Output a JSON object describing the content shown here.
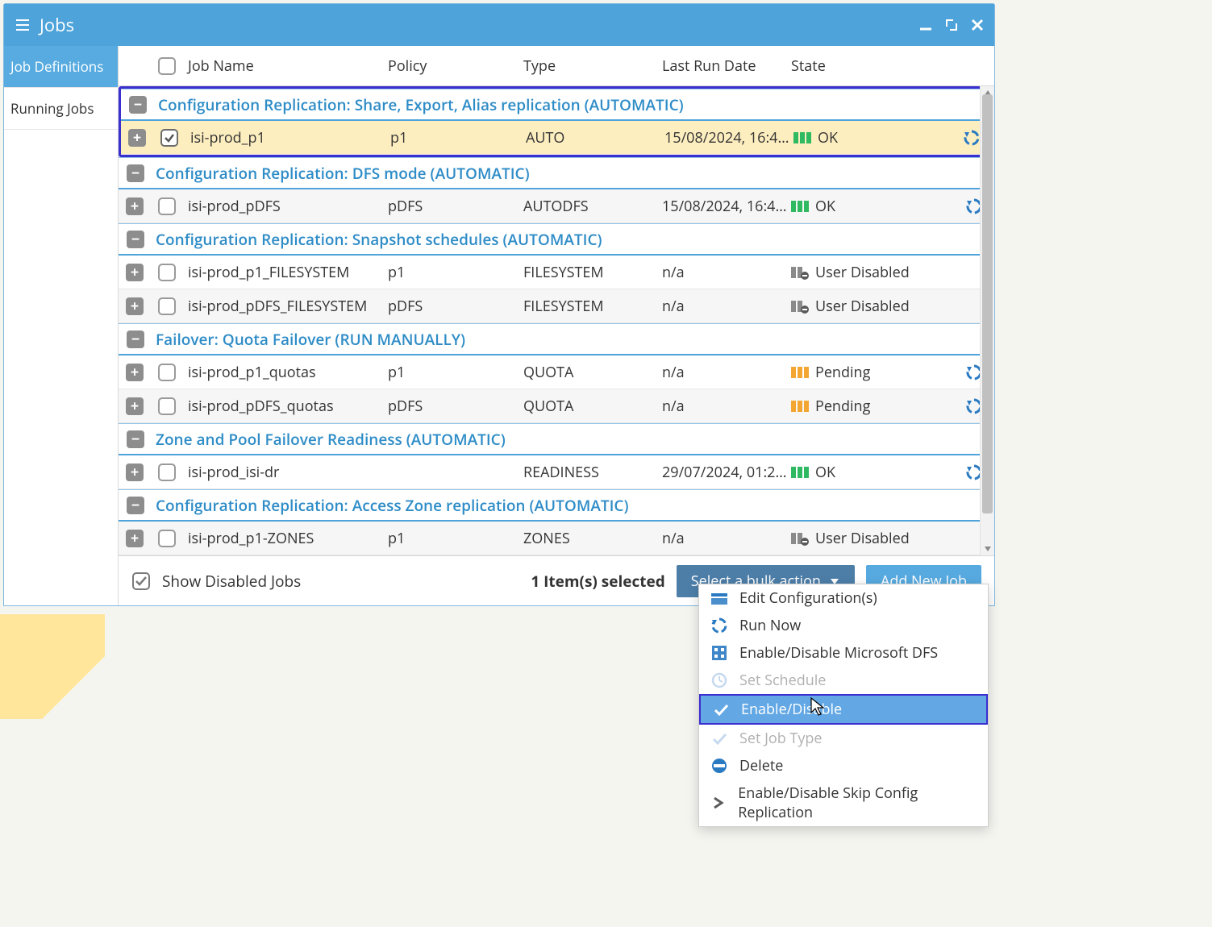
{
  "window": {
    "title": "Jobs"
  },
  "sidebar": {
    "tabs": [
      {
        "label": "Job Definitions",
        "active": true
      },
      {
        "label": "Running Jobs",
        "active": false
      }
    ]
  },
  "columns": {
    "name": "Job Name",
    "policy": "Policy",
    "type": "Type",
    "date": "Last Run Date",
    "state": "State"
  },
  "groups": [
    {
      "title": "Configuration Replication: Share, Export, Alias replication (AUTOMATIC)",
      "highlighted": true,
      "rows": [
        {
          "name": "isi-prod_p1",
          "policy": "p1",
          "type": "AUTO",
          "date": "15/08/2024, 16:4…",
          "state": "OK",
          "state_kind": "ok",
          "checked": true,
          "action": true,
          "selected": true
        }
      ]
    },
    {
      "title": "Configuration Replication: DFS mode (AUTOMATIC)",
      "rows": [
        {
          "name": "isi-prod_pDFS",
          "policy": "pDFS",
          "type": "AUTODFS",
          "date": "15/08/2024, 16:4…",
          "state": "OK",
          "state_kind": "ok",
          "action": true,
          "alt": true
        }
      ]
    },
    {
      "title": "Configuration Replication: Snapshot schedules (AUTOMATIC)",
      "rows": [
        {
          "name": "isi-prod_p1_FILESYSTEM",
          "policy": "p1",
          "type": "FILESYSTEM",
          "date": "n/a",
          "state": "User Disabled",
          "state_kind": "disabled"
        },
        {
          "name": "isi-prod_pDFS_FILESYSTEM",
          "policy": "pDFS",
          "type": "FILESYSTEM",
          "date": "n/a",
          "state": "User Disabled",
          "state_kind": "disabled",
          "alt": true
        }
      ]
    },
    {
      "title": "Failover: Quota Failover (RUN MANUALLY)",
      "rows": [
        {
          "name": "isi-prod_p1_quotas",
          "policy": "p1",
          "type": "QUOTA",
          "date": "n/a",
          "state": "Pending",
          "state_kind": "pending",
          "action": true
        },
        {
          "name": "isi-prod_pDFS_quotas",
          "policy": "pDFS",
          "type": "QUOTA",
          "date": "n/a",
          "state": "Pending",
          "state_kind": "pending",
          "action": true,
          "alt": true
        }
      ]
    },
    {
      "title": "Zone and Pool Failover Readiness (AUTOMATIC)",
      "rows": [
        {
          "name": "isi-prod_isi-dr",
          "policy": "",
          "type": "READINESS",
          "date": "29/07/2024, 01:2…",
          "state": "OK",
          "state_kind": "ok",
          "action": true
        }
      ]
    },
    {
      "title": "Configuration Replication: Access Zone replication (AUTOMATIC)",
      "rows": [
        {
          "name": "isi-prod_p1-ZONES",
          "policy": "p1",
          "type": "ZONES",
          "date": "n/a",
          "state": "User Disabled",
          "state_kind": "disabled",
          "alt": true
        }
      ]
    }
  ],
  "footer": {
    "show_disabled": "Show Disabled Jobs",
    "selected_count": "1 Item(s) selected",
    "bulk_label": "Select a bulk action",
    "add_label": "Add New Job"
  },
  "menu": {
    "items": [
      {
        "label": "Edit Configuration(s)",
        "icon": "edit"
      },
      {
        "label": "Run Now",
        "icon": "cycle"
      },
      {
        "label": "Enable/Disable Microsoft DFS",
        "icon": "dfs"
      },
      {
        "label": "Set Schedule",
        "icon": "clock",
        "disabled": true
      },
      {
        "label": "Enable/Disable",
        "icon": "check",
        "highlight": true
      },
      {
        "label": "Set Job Type",
        "icon": "check",
        "disabled": true
      },
      {
        "label": "Delete",
        "icon": "delete"
      },
      {
        "label": "Enable/Disable Skip Config Replication",
        "icon": "chevron"
      }
    ]
  }
}
